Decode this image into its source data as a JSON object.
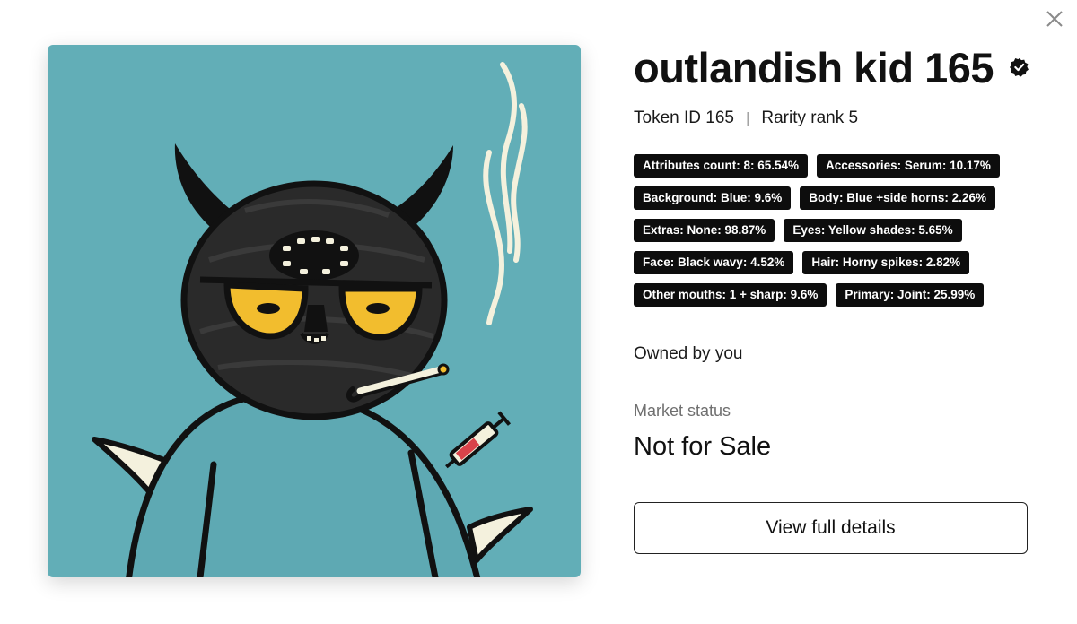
{
  "nft": {
    "title": "outlandish kid 165",
    "token_id": "Token ID 165",
    "rarity": "Rarity rank 5",
    "owner": "Owned by you",
    "market_label": "Market status",
    "market_value": "Not for Sale",
    "details_button": "View full details"
  },
  "attributes": [
    "Attributes count: 8: 65.54%",
    "Accessories: Serum: 10.17%",
    "Background: Blue: 9.6%",
    "Body: Blue +side horns: 2.26%",
    "Extras: None: 98.87%",
    "Eyes: Yellow shades: 5.65%",
    "Face: Black wavy: 4.52%",
    "Hair: Horny spikes: 2.82%",
    "Other mouths: 1 + sharp: 9.6%",
    "Primary: Joint: 25.99%"
  ],
  "icons": {
    "close": "close-icon",
    "verified": "verified-badge-icon"
  },
  "colors": {
    "art_background": "#62aeb7",
    "body_blue": "#5ea9b3",
    "head_black": "#2a2a2a",
    "shades_yellow": "#f2bd2e",
    "tag_background": "#0d0d0d"
  }
}
